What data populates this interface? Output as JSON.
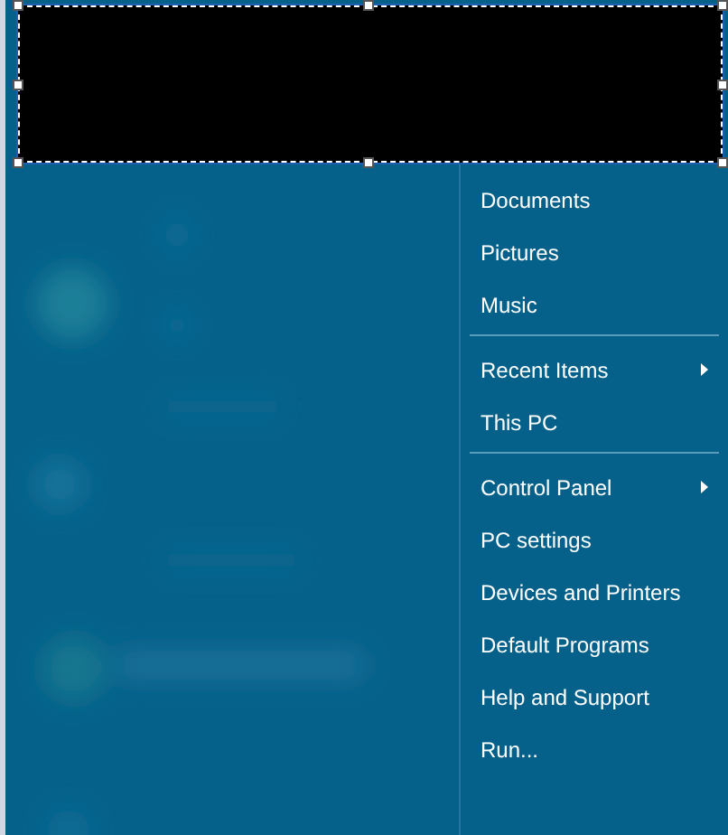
{
  "menu": {
    "items": [
      {
        "kind": "item",
        "label": "Documents"
      },
      {
        "kind": "item",
        "label": "Pictures"
      },
      {
        "kind": "item",
        "label": "Music"
      },
      {
        "kind": "separator"
      },
      {
        "kind": "submenu",
        "label": "Recent Items"
      },
      {
        "kind": "item",
        "label": "This PC"
      },
      {
        "kind": "separator"
      },
      {
        "kind": "submenu",
        "label": "Control Panel"
      },
      {
        "kind": "item",
        "label": "PC settings"
      },
      {
        "kind": "item",
        "label": "Devices and Printers"
      },
      {
        "kind": "item",
        "label": "Default Programs"
      },
      {
        "kind": "item",
        "label": "Help and Support"
      },
      {
        "kind": "item",
        "label": "Run..."
      }
    ]
  }
}
